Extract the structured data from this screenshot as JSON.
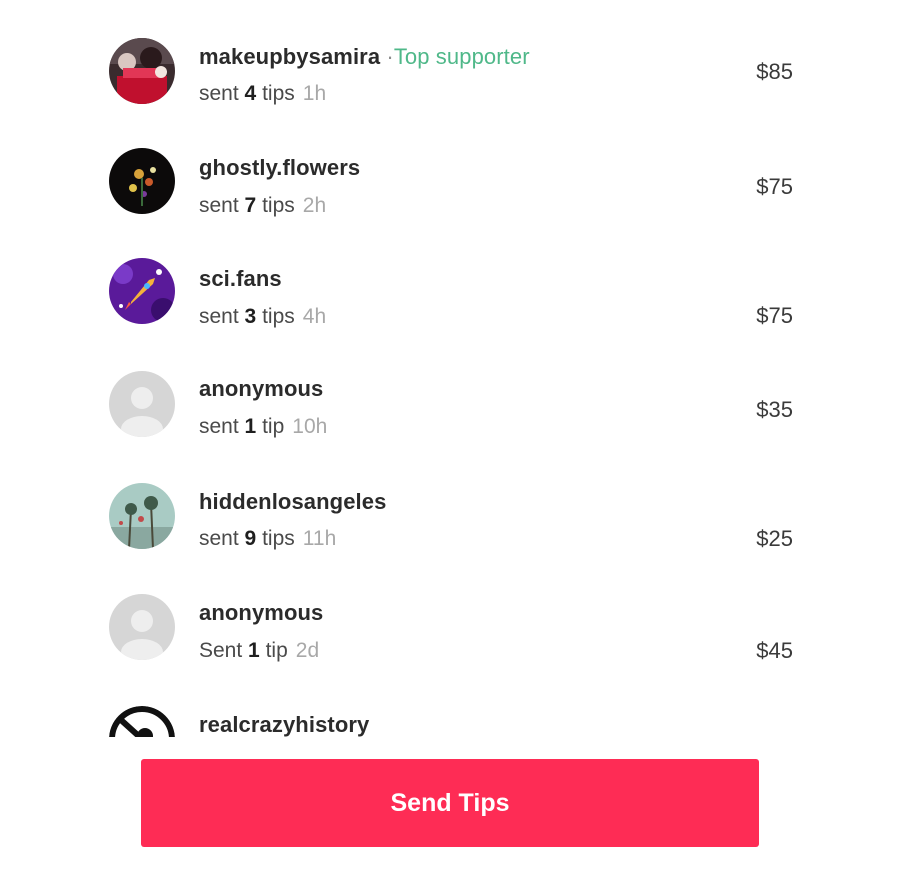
{
  "supporters": [
    {
      "username": "makeupbysamira",
      "badge": "Top supporter",
      "sent_prefix": "sent",
      "tip_count": "4",
      "tip_word": "tips",
      "time": "1h",
      "amount": "$85",
      "avatar_icon": "makeup-photo-avatar"
    },
    {
      "username": "ghostly.flowers",
      "sent_prefix": "sent",
      "tip_count": "7",
      "tip_word": "tips",
      "time": "2h",
      "amount": "$75",
      "avatar_icon": "flowers-photo-avatar"
    },
    {
      "username": "sci.fans",
      "sent_prefix": "sent",
      "tip_count": "3",
      "tip_word": "tips",
      "time": "4h",
      "amount": "$75",
      "avatar_icon": "rocket-avatar"
    },
    {
      "username": "anonymous",
      "sent_prefix": "sent",
      "tip_count": "1",
      "tip_word": "tip",
      "time": "10h",
      "amount": "$35",
      "avatar_icon": "default-user-avatar"
    },
    {
      "username": "hiddenlosangeles",
      "sent_prefix": "sent",
      "tip_count": "9",
      "tip_word": "tips",
      "time": "11h",
      "amount": "$25",
      "avatar_icon": "palm-trees-photo-avatar"
    },
    {
      "username": "anonymous",
      "sent_prefix": "Sent",
      "tip_count": "1",
      "tip_word": "tip",
      "time": "2d",
      "amount": "$45",
      "avatar_icon": "default-user-avatar"
    },
    {
      "username": "realcrazyhistory",
      "avatar_icon": "history-logo-avatar"
    }
  ],
  "badge_separator": "·",
  "send_button": {
    "label": "Send Tips"
  },
  "colors": {
    "accent": "#fe2c55",
    "badge": "#4fb889"
  }
}
